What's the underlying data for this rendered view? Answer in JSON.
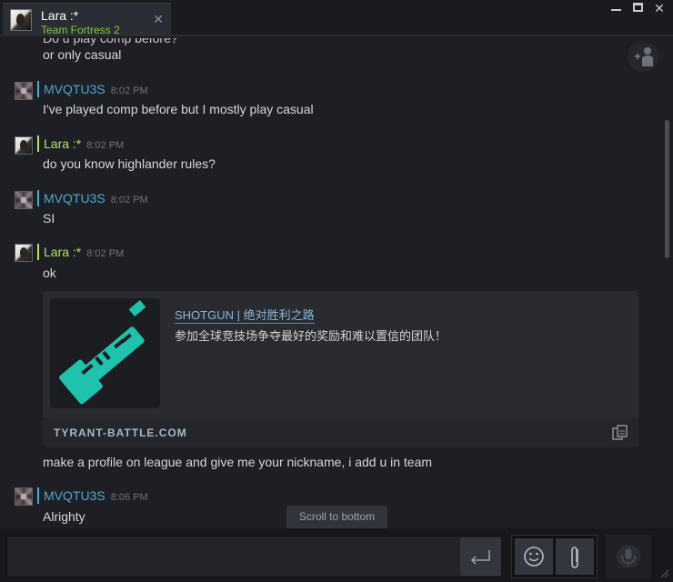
{
  "tab": {
    "name": "Lara :*",
    "game": "Team Fortress 2",
    "close_glyph": "✕"
  },
  "window": {
    "minimize_icon": "minimize-icon",
    "maximize_icon": "maximize-icon",
    "close_glyph": "✕"
  },
  "messages": {
    "cutoff_line": "Do u play comp before?",
    "line_casual": "or only casual",
    "groups": [
      {
        "sender": "MVQTU3S",
        "time": "8:02 PM",
        "text": "I've played comp before but I mostly play casual"
      },
      {
        "sender": "Lara :*",
        "time": "8:02 PM",
        "text": "do you know highlander rules?"
      },
      {
        "sender": "MVQTU3S",
        "time": "8:02 PM",
        "text": "SI"
      },
      {
        "sender": "Lara :*",
        "time": "8:02 PM",
        "text": "ok"
      },
      {
        "sender": "MVQTU3S",
        "time": "8:06 PM",
        "text": "Alrighty"
      }
    ],
    "after_embed": "make a profile on league and give me your nickname, i add u in team"
  },
  "embed": {
    "title": "SHOTGUN | 绝对胜利之路",
    "description": "参加全球竞技场争夺最好的奖励和难以置信的团队！",
    "domain": "TYRANT-BATTLE.COM",
    "thumb_icon": "shotgun-icon",
    "copy_icon": "copy-icon"
  },
  "scroll_to_bottom": "Scroll to bottom",
  "composer": {
    "placeholder": "",
    "value": ""
  },
  "colors": {
    "background": "#1e1f24",
    "friend_name_blue": "#4ea8cf",
    "self_name_green": "#b7e06a",
    "game_green": "#8bc53f",
    "embed_teal": "#1fc3ad"
  }
}
